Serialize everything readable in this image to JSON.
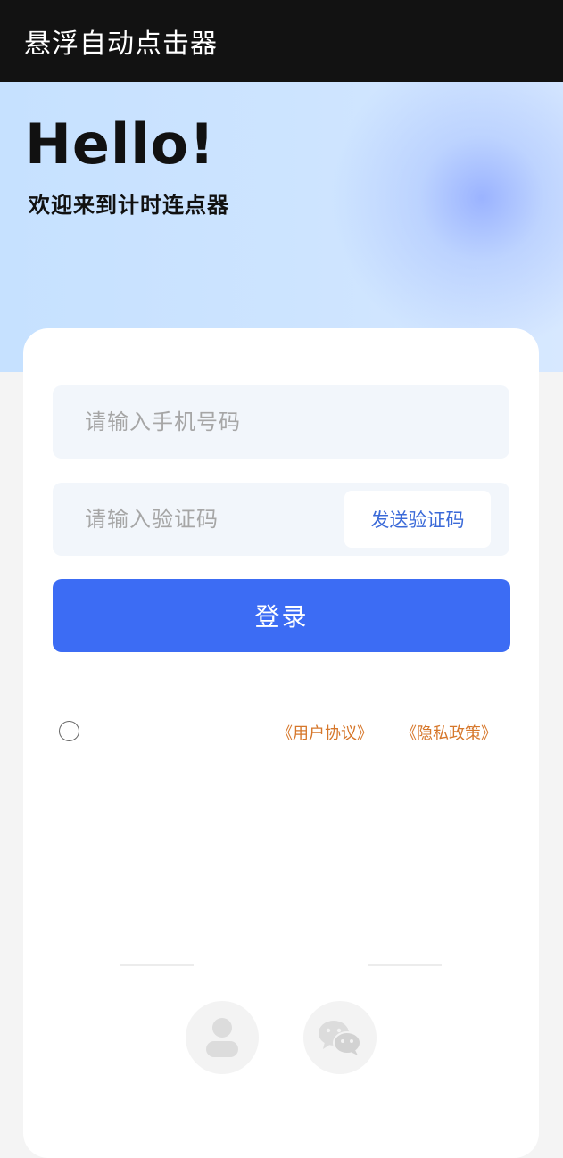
{
  "app_bar": {
    "title": "悬浮自动点击器",
    "background": "#121212"
  },
  "hero": {
    "greeting": "Hello!",
    "subtitle": "欢迎来到计时连点器"
  },
  "form": {
    "phone_placeholder": "请输入手机号码",
    "code_placeholder": "请输入验证码",
    "send_code_label": "发送验证码",
    "login_label": "登录"
  },
  "agreement": {
    "checked": false,
    "terms_link": "《用户协议》",
    "privacy_link": "《隐私政策》"
  },
  "social_login": [
    {
      "icon": "user-icon"
    },
    {
      "icon": "wechat-icon"
    }
  ],
  "colors": {
    "accent": "#3c6cf4",
    "link": "#d6772b",
    "send_code_text": "#3b6ad8"
  }
}
